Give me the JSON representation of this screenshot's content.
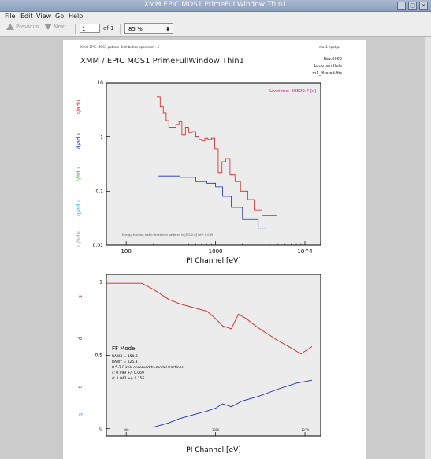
{
  "window": {
    "title": "XMM EPIC MOS1 PrimeFullWindow Thin1"
  },
  "menu": [
    "File",
    "Edit",
    "View",
    "Go",
    "Help"
  ],
  "toolbar": {
    "previous": "Previous",
    "next": "Next",
    "page_value": "1",
    "of_label": "of 1",
    "zoom": "85 %"
  },
  "doc": {
    "header_left": "Xmdl EPIC MOS1 pattern distribution spectrum . 5",
    "header_right": "mos1 epat.ps",
    "title": "XMM / EPIC MOS1 PrimeFullWindow Thin1",
    "info_line1": "Rev.0000",
    "info_line2": "Lockman Hole",
    "info_line3": "m1_filtered.fits",
    "livetime": "Livetime: 39529.7 [s]",
    "footnote": "Energy fraction lost in fractional patterns in [0.5-2.0] keV: 0.089",
    "ff_model": "FF Model",
    "rawx": "RAWX = 150.6",
    "rawy": "RAWY = 125.3",
    "fractions_header": "0.5-2.0 keV observed-to-model fractions:",
    "frac_s": "s: 0.999 +/- 0.069",
    "frac_d": "d: 1.041 +/- 0.156"
  },
  "chart_data": [
    {
      "type": "line",
      "xlabel": "PI Channel [eV]",
      "ylabels": [
        "s/adu",
        "d/adu",
        "t/adu",
        "q/adu",
        "u/adu"
      ],
      "log_x": true,
      "log_y": true,
      "xlim": [
        60,
        15000
      ],
      "ylim": [
        0.01,
        10
      ],
      "x_tick_labels": [
        "100",
        "1000",
        "10^4"
      ],
      "y_tick_labels": [
        "10",
        "1",
        "0.1",
        "0.01"
      ],
      "colors": {
        "s": "#dd1f1f",
        "d": "#1d2cc4",
        "t": "#27c427",
        "q": "#1fc8e6",
        "u": "#9a9a9a"
      },
      "series": [
        {
          "name": "s",
          "x": [
            220,
            240,
            260,
            280,
            300,
            330,
            360,
            390,
            420,
            460,
            500,
            550,
            600,
            650,
            700,
            760,
            820,
            900,
            980,
            1070,
            1180,
            1300,
            1450,
            1650,
            1900,
            2300,
            2700,
            3300,
            4000
          ],
          "y": [
            5.5,
            3.6,
            2.8,
            2.0,
            1.5,
            1.5,
            1.7,
            1.9,
            1.1,
            1.5,
            1.2,
            1.25,
            1.0,
            0.9,
            0.85,
            0.95,
            0.9,
            0.95,
            0.6,
            0.22,
            0.35,
            0.4,
            0.2,
            0.15,
            0.1,
            0.07,
            0.045,
            0.035,
            0.035
          ]
        },
        {
          "name": "d",
          "x": [
            230,
            400,
            600,
            800,
            1000,
            1200,
            1500,
            2000,
            3000
          ],
          "y": [
            0.19,
            0.18,
            0.15,
            0.14,
            0.12,
            0.08,
            0.05,
            0.03,
            0.02
          ]
        }
      ]
    },
    {
      "type": "line",
      "xlabel": "PI Channel [eV]",
      "ylabels": [
        "s",
        "d",
        "t",
        "q"
      ],
      "log_x": true,
      "xlim": [
        60,
        15000
      ],
      "ylim": [
        -0.05,
        1.05
      ],
      "y_tick_labels": [
        "1",
        "0.5",
        "0"
      ],
      "x_tick_labels": [
        "100",
        "1000",
        "10^4"
      ],
      "series": [
        {
          "name": "s",
          "x": [
            60,
            150,
            200,
            300,
            400,
            600,
            800,
            1000,
            1200,
            1500,
            1800,
            2200,
            2800,
            3500,
            5000,
            7000,
            9000,
            12000
          ],
          "y": [
            0.99,
            0.99,
            0.95,
            0.88,
            0.85,
            0.82,
            0.8,
            0.75,
            0.7,
            0.68,
            0.78,
            0.75,
            0.7,
            0.66,
            0.6,
            0.55,
            0.51,
            0.56
          ]
        },
        {
          "name": "d",
          "x": [
            200,
            300,
            400,
            600,
            800,
            1000,
            1200,
            1500,
            2000,
            3000,
            5000,
            8000,
            12000
          ],
          "y": [
            0.01,
            0.04,
            0.07,
            0.1,
            0.12,
            0.14,
            0.17,
            0.15,
            0.19,
            0.22,
            0.27,
            0.31,
            0.33
          ]
        }
      ]
    }
  ]
}
